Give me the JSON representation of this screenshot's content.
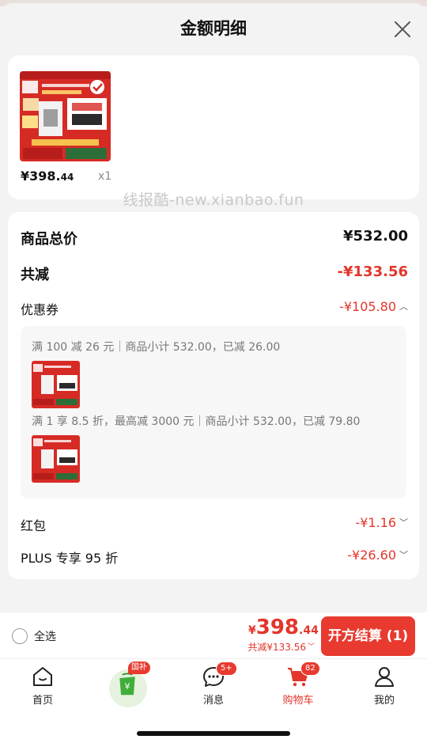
{
  "header": {
    "title": "金额明细"
  },
  "product": {
    "price_prefix": "¥398.",
    "price_dec": "44",
    "qty": "x1"
  },
  "watermark": "线报酷-new.xianbao.fun",
  "detail": {
    "total_label": "商品总价",
    "total_value": "¥532.00",
    "reduce_label": "共减",
    "reduce_value": "-¥133.56",
    "coupon_label": "优惠券",
    "coupon_value": "-¥105.80",
    "coupon_rules": [
      "满 100 减 26 元｜商品小计 532.00，已减 26.00",
      "满 1 享 8.5 折，最高减 3000 元｜商品小计 532.00，已减 79.80"
    ],
    "red_label": "红包",
    "red_value": "-¥1.16",
    "plus_label": "PLUS 专享 95 折",
    "plus_value": "-¥26.60"
  },
  "footer": {
    "select_all": "全选",
    "price_cur": "¥",
    "price_int": "398",
    "price_dec": ".44",
    "reduce_text": "共减¥133.56",
    "checkout": "开方结算 (1)"
  },
  "tabs": [
    {
      "label": "首页"
    },
    {
      "label": "",
      "badge": "国补"
    },
    {
      "label": "消息",
      "badge": "5+"
    },
    {
      "label": "购物车",
      "badge": "82"
    },
    {
      "label": "我的"
    }
  ],
  "colors": {
    "accent": "#e83a2f",
    "price_red": "#e2362b"
  }
}
